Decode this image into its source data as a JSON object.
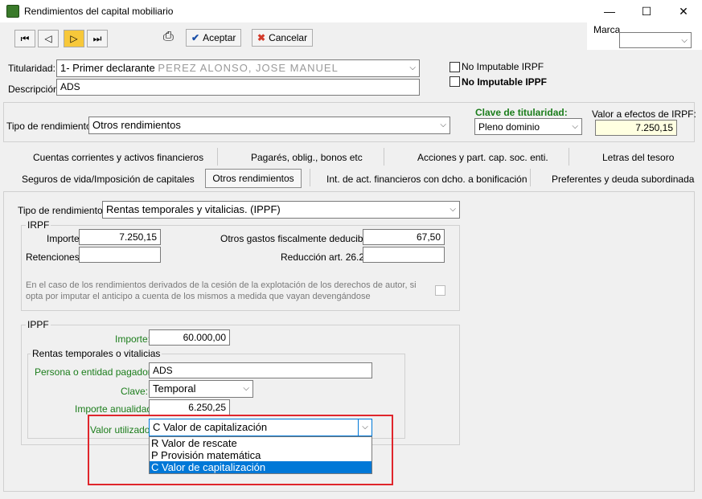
{
  "window": {
    "title": "Rendimientos del capital mobiliario",
    "app_icon_glyph": "",
    "minimize": "—",
    "maximize": "☐",
    "close": "✕"
  },
  "toolbar": {
    "first": "⏮",
    "prev": "◁",
    "next": "▷",
    "last": "⏭",
    "print_icon": "⎙",
    "accept_label": "Aceptar",
    "cancel_label": "Cancelar",
    "marca_label": "Marca",
    "marca_value": ""
  },
  "header": {
    "titularidad_label": "Titularidad:",
    "titularidad_value": "1- Primer declarante",
    "titularidad_blurred": "PEREZ ALONSO, JOSE MANUEL",
    "descripcion_label": "Descripción:",
    "descripcion_value": "ADS",
    "no_imputable_irpf": "No Imputable IRPF",
    "no_imputable_ippf": "No Imputable IPPF"
  },
  "tipo_section": {
    "tipo_label": "Tipo de rendimiento:",
    "tipo_value": "Otros rendimientos",
    "clave_titularidad_label": "Clave de titularidad:",
    "clave_titularidad_value": "Pleno dominio",
    "valor_irpf_label": "Valor a efectos de IRPF:",
    "valor_irpf_value": "7.250,15"
  },
  "tabs": {
    "row1": [
      "Cuentas corrientes y activos financieros",
      "Pagarés, oblig., bonos etc",
      "Acciones y part. cap. soc. enti.",
      "Letras del tesoro"
    ],
    "row2": [
      "Seguros de vida/Imposición de capitales",
      "Otros rendimientos",
      "Int. de act. financieros con dcho. a bonificación",
      "Preferentes y deuda subordinada"
    ]
  },
  "detail": {
    "tipo_label": "Tipo de rendimiento:",
    "tipo_value": "Rentas temporales y vitalicias. (IPPF)",
    "irpf": {
      "title": "IRPF",
      "importe_label": "Importe:",
      "importe_value": "7.250,15",
      "retenciones_label": "Retenciones:",
      "retenciones_value": "",
      "otros_gastos_label": "Otros gastos fiscalmente deducibles:",
      "otros_gastos_value": "67,50",
      "reduccion_label": "Reducción art. 26.2:",
      "reduccion_value": "",
      "note": "En el caso de los rendimientos derivados de la cesión de la explotación de los derechos de autor, si opta por imputar el anticipo a cuenta de los mismos a medida que vayan devengándose"
    },
    "ippf": {
      "title": "IPPF",
      "importe_label": "Importe:",
      "importe_value": "60.000,00",
      "rentas_title": "Rentas temporales o vitalicias",
      "persona_label": "Persona o entidad pagadora:",
      "persona_value": "ADS",
      "clave_label": "Clave:",
      "clave_value": "Temporal",
      "importe_anual_label": "Importe anualidad:",
      "importe_anual_value": "6.250,25",
      "valor_label": "Valor utilizado:",
      "valor_value": "C Valor de capitalización",
      "options": [
        "R Valor de rescate",
        "P Provisión matemática",
        "C Valor de capitalización"
      ]
    }
  }
}
